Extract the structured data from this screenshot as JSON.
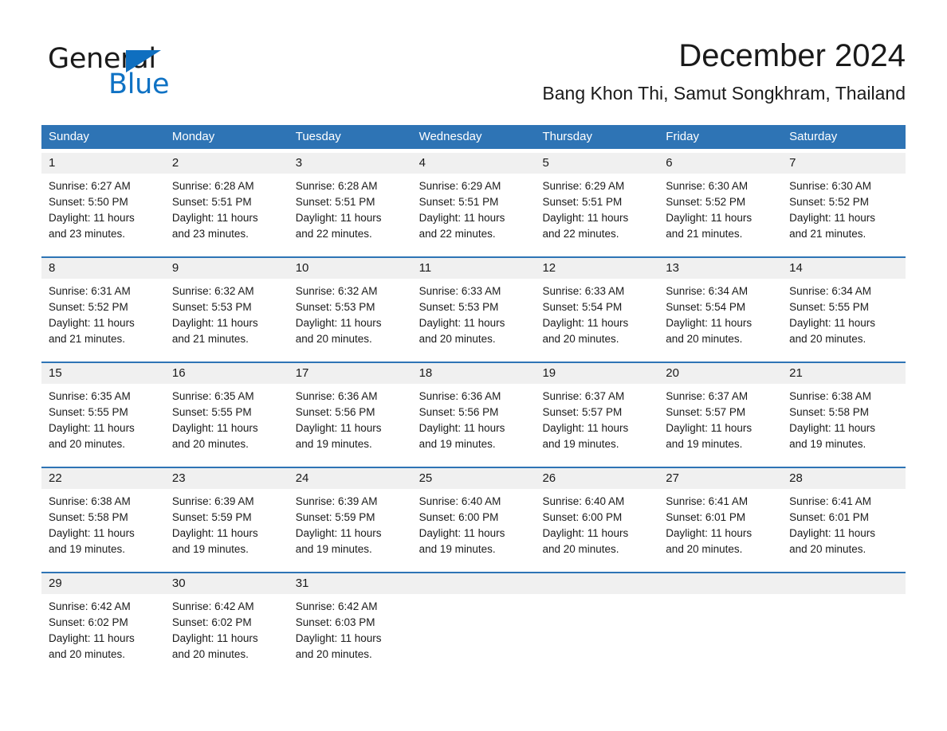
{
  "brand": {
    "word_one": "General",
    "word_two": "Blue",
    "triangle_color": "#0f6fc0",
    "blue_text_color": "#0f72c4"
  },
  "header": {
    "title": "December 2024",
    "subtitle": "Bang Khon Thi, Samut Songkhram, Thailand"
  },
  "colors": {
    "header_bar": "#2e74b5",
    "row_rule": "#2e74b5",
    "daynum_band": "#f0f0f0",
    "text": "#1a1a1a",
    "page_background": "#ffffff"
  },
  "weekdays": [
    "Sunday",
    "Monday",
    "Tuesday",
    "Wednesday",
    "Thursday",
    "Friday",
    "Saturday"
  ],
  "weeks": [
    [
      {
        "day": "1",
        "sunrise": "Sunrise: 6:27 AM",
        "sunset": "Sunset: 5:50 PM",
        "daylight_line1": "Daylight: 11 hours",
        "daylight_line2": "and 23 minutes."
      },
      {
        "day": "2",
        "sunrise": "Sunrise: 6:28 AM",
        "sunset": "Sunset: 5:51 PM",
        "daylight_line1": "Daylight: 11 hours",
        "daylight_line2": "and 23 minutes."
      },
      {
        "day": "3",
        "sunrise": "Sunrise: 6:28 AM",
        "sunset": "Sunset: 5:51 PM",
        "daylight_line1": "Daylight: 11 hours",
        "daylight_line2": "and 22 minutes."
      },
      {
        "day": "4",
        "sunrise": "Sunrise: 6:29 AM",
        "sunset": "Sunset: 5:51 PM",
        "daylight_line1": "Daylight: 11 hours",
        "daylight_line2": "and 22 minutes."
      },
      {
        "day": "5",
        "sunrise": "Sunrise: 6:29 AM",
        "sunset": "Sunset: 5:51 PM",
        "daylight_line1": "Daylight: 11 hours",
        "daylight_line2": "and 22 minutes."
      },
      {
        "day": "6",
        "sunrise": "Sunrise: 6:30 AM",
        "sunset": "Sunset: 5:52 PM",
        "daylight_line1": "Daylight: 11 hours",
        "daylight_line2": "and 21 minutes."
      },
      {
        "day": "7",
        "sunrise": "Sunrise: 6:30 AM",
        "sunset": "Sunset: 5:52 PM",
        "daylight_line1": "Daylight: 11 hours",
        "daylight_line2": "and 21 minutes."
      }
    ],
    [
      {
        "day": "8",
        "sunrise": "Sunrise: 6:31 AM",
        "sunset": "Sunset: 5:52 PM",
        "daylight_line1": "Daylight: 11 hours",
        "daylight_line2": "and 21 minutes."
      },
      {
        "day": "9",
        "sunrise": "Sunrise: 6:32 AM",
        "sunset": "Sunset: 5:53 PM",
        "daylight_line1": "Daylight: 11 hours",
        "daylight_line2": "and 21 minutes."
      },
      {
        "day": "10",
        "sunrise": "Sunrise: 6:32 AM",
        "sunset": "Sunset: 5:53 PM",
        "daylight_line1": "Daylight: 11 hours",
        "daylight_line2": "and 20 minutes."
      },
      {
        "day": "11",
        "sunrise": "Sunrise: 6:33 AM",
        "sunset": "Sunset: 5:53 PM",
        "daylight_line1": "Daylight: 11 hours",
        "daylight_line2": "and 20 minutes."
      },
      {
        "day": "12",
        "sunrise": "Sunrise: 6:33 AM",
        "sunset": "Sunset: 5:54 PM",
        "daylight_line1": "Daylight: 11 hours",
        "daylight_line2": "and 20 minutes."
      },
      {
        "day": "13",
        "sunrise": "Sunrise: 6:34 AM",
        "sunset": "Sunset: 5:54 PM",
        "daylight_line1": "Daylight: 11 hours",
        "daylight_line2": "and 20 minutes."
      },
      {
        "day": "14",
        "sunrise": "Sunrise: 6:34 AM",
        "sunset": "Sunset: 5:55 PM",
        "daylight_line1": "Daylight: 11 hours",
        "daylight_line2": "and 20 minutes."
      }
    ],
    [
      {
        "day": "15",
        "sunrise": "Sunrise: 6:35 AM",
        "sunset": "Sunset: 5:55 PM",
        "daylight_line1": "Daylight: 11 hours",
        "daylight_line2": "and 20 minutes."
      },
      {
        "day": "16",
        "sunrise": "Sunrise: 6:35 AM",
        "sunset": "Sunset: 5:55 PM",
        "daylight_line1": "Daylight: 11 hours",
        "daylight_line2": "and 20 minutes."
      },
      {
        "day": "17",
        "sunrise": "Sunrise: 6:36 AM",
        "sunset": "Sunset: 5:56 PM",
        "daylight_line1": "Daylight: 11 hours",
        "daylight_line2": "and 19 minutes."
      },
      {
        "day": "18",
        "sunrise": "Sunrise: 6:36 AM",
        "sunset": "Sunset: 5:56 PM",
        "daylight_line1": "Daylight: 11 hours",
        "daylight_line2": "and 19 minutes."
      },
      {
        "day": "19",
        "sunrise": "Sunrise: 6:37 AM",
        "sunset": "Sunset: 5:57 PM",
        "daylight_line1": "Daylight: 11 hours",
        "daylight_line2": "and 19 minutes."
      },
      {
        "day": "20",
        "sunrise": "Sunrise: 6:37 AM",
        "sunset": "Sunset: 5:57 PM",
        "daylight_line1": "Daylight: 11 hours",
        "daylight_line2": "and 19 minutes."
      },
      {
        "day": "21",
        "sunrise": "Sunrise: 6:38 AM",
        "sunset": "Sunset: 5:58 PM",
        "daylight_line1": "Daylight: 11 hours",
        "daylight_line2": "and 19 minutes."
      }
    ],
    [
      {
        "day": "22",
        "sunrise": "Sunrise: 6:38 AM",
        "sunset": "Sunset: 5:58 PM",
        "daylight_line1": "Daylight: 11 hours",
        "daylight_line2": "and 19 minutes."
      },
      {
        "day": "23",
        "sunrise": "Sunrise: 6:39 AM",
        "sunset": "Sunset: 5:59 PM",
        "daylight_line1": "Daylight: 11 hours",
        "daylight_line2": "and 19 minutes."
      },
      {
        "day": "24",
        "sunrise": "Sunrise: 6:39 AM",
        "sunset": "Sunset: 5:59 PM",
        "daylight_line1": "Daylight: 11 hours",
        "daylight_line2": "and 19 minutes."
      },
      {
        "day": "25",
        "sunrise": "Sunrise: 6:40 AM",
        "sunset": "Sunset: 6:00 PM",
        "daylight_line1": "Daylight: 11 hours",
        "daylight_line2": "and 19 minutes."
      },
      {
        "day": "26",
        "sunrise": "Sunrise: 6:40 AM",
        "sunset": "Sunset: 6:00 PM",
        "daylight_line1": "Daylight: 11 hours",
        "daylight_line2": "and 20 minutes."
      },
      {
        "day": "27",
        "sunrise": "Sunrise: 6:41 AM",
        "sunset": "Sunset: 6:01 PM",
        "daylight_line1": "Daylight: 11 hours",
        "daylight_line2": "and 20 minutes."
      },
      {
        "day": "28",
        "sunrise": "Sunrise: 6:41 AM",
        "sunset": "Sunset: 6:01 PM",
        "daylight_line1": "Daylight: 11 hours",
        "daylight_line2": "and 20 minutes."
      }
    ],
    [
      {
        "day": "29",
        "sunrise": "Sunrise: 6:42 AM",
        "sunset": "Sunset: 6:02 PM",
        "daylight_line1": "Daylight: 11 hours",
        "daylight_line2": "and 20 minutes."
      },
      {
        "day": "30",
        "sunrise": "Sunrise: 6:42 AM",
        "sunset": "Sunset: 6:02 PM",
        "daylight_line1": "Daylight: 11 hours",
        "daylight_line2": "and 20 minutes."
      },
      {
        "day": "31",
        "sunrise": "Sunrise: 6:42 AM",
        "sunset": "Sunset: 6:03 PM",
        "daylight_line1": "Daylight: 11 hours",
        "daylight_line2": "and 20 minutes."
      },
      {
        "day": "",
        "sunrise": "",
        "sunset": "",
        "daylight_line1": "",
        "daylight_line2": ""
      },
      {
        "day": "",
        "sunrise": "",
        "sunset": "",
        "daylight_line1": "",
        "daylight_line2": ""
      },
      {
        "day": "",
        "sunrise": "",
        "sunset": "",
        "daylight_line1": "",
        "daylight_line2": ""
      },
      {
        "day": "",
        "sunrise": "",
        "sunset": "",
        "daylight_line1": "",
        "daylight_line2": ""
      }
    ]
  ]
}
